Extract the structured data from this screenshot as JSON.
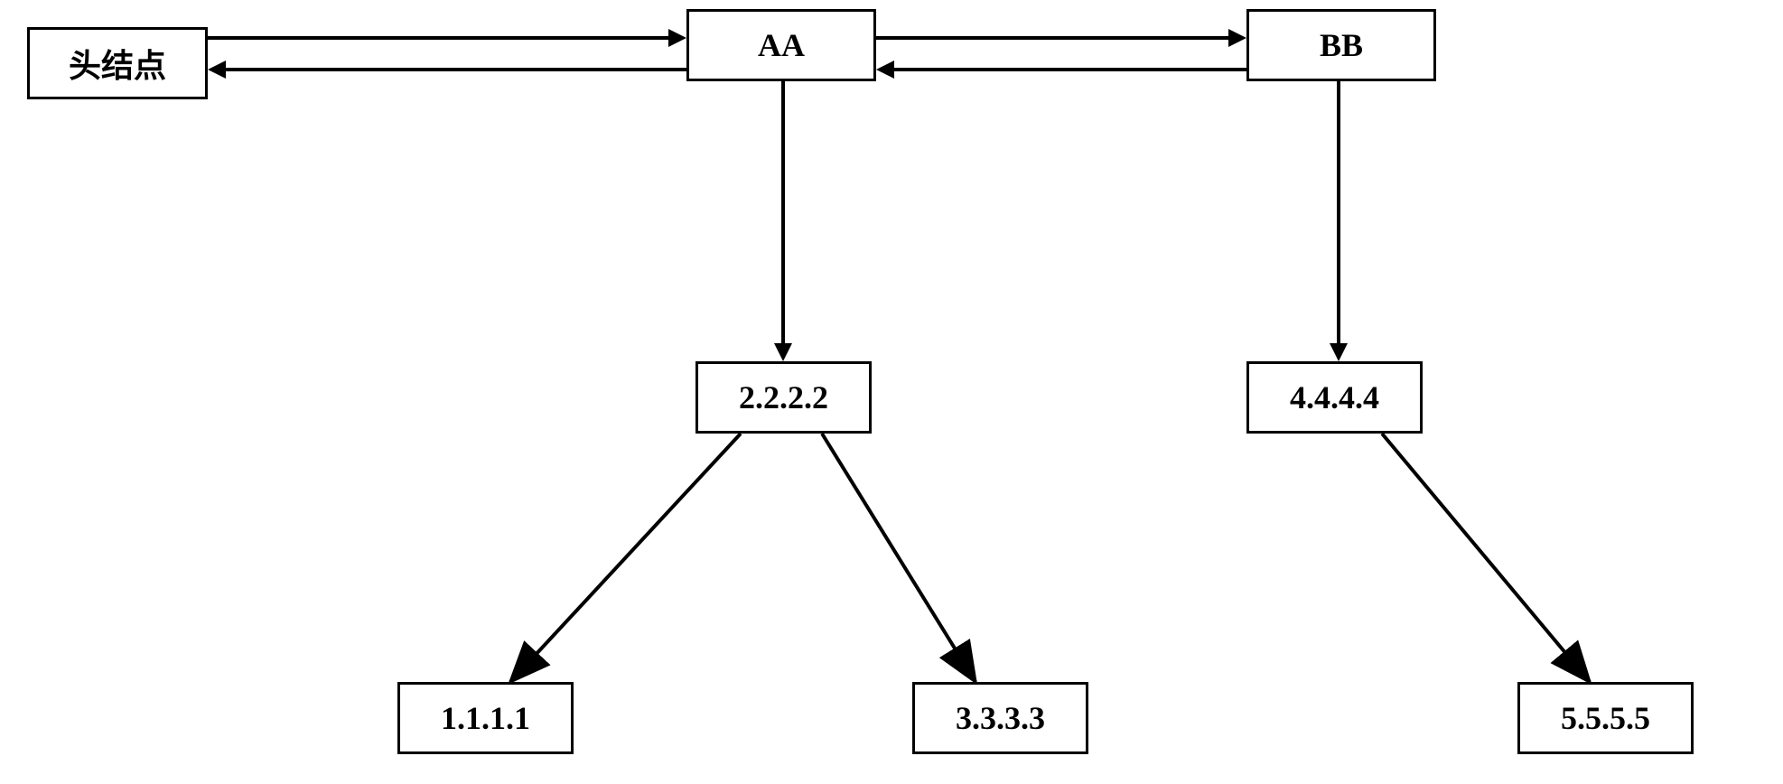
{
  "nodes": {
    "head": "头结点",
    "aa": "AA",
    "bb": "BB",
    "n2222": "2.2.2.2",
    "n4444": "4.4.4.4",
    "n1111": "1.1.1.1",
    "n3333": "3.3.3.3",
    "n5555": "5.5.5.5"
  }
}
